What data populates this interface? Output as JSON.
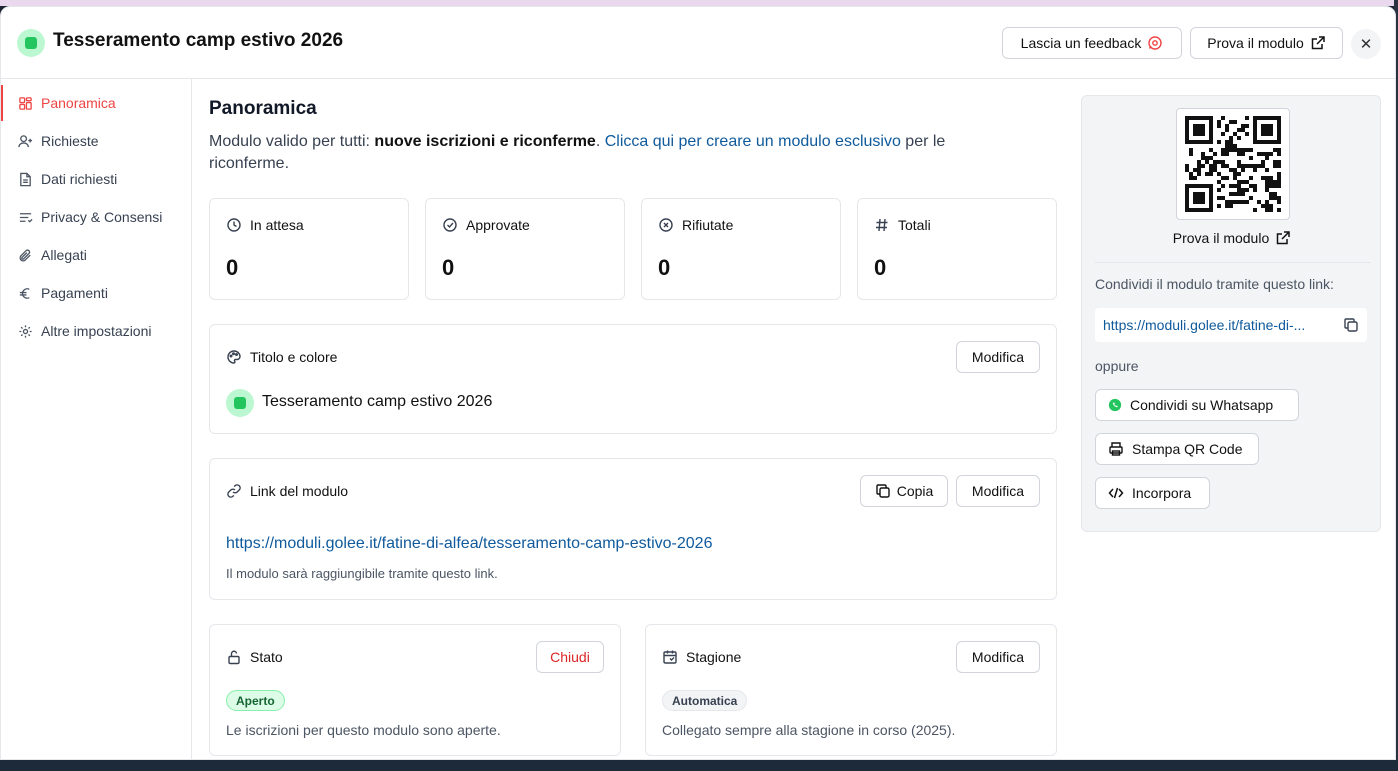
{
  "header": {
    "title": "Tesseramento camp estivo 2026",
    "feedback_label": "Lascia un feedback",
    "try_label": "Prova il modulo",
    "close_symbol": "✕",
    "accent_color": "#22c55e"
  },
  "sidebar": {
    "items": [
      {
        "label": "Panoramica",
        "icon": "grid-icon"
      },
      {
        "label": "Richieste",
        "icon": "user-plus-icon"
      },
      {
        "label": "Dati richiesti",
        "icon": "file-icon"
      },
      {
        "label": "Privacy & Consensi",
        "icon": "list-icon"
      },
      {
        "label": "Allegati",
        "icon": "paperclip-icon"
      },
      {
        "label": "Pagamenti",
        "icon": "euro-icon"
      },
      {
        "label": "Altre impostazioni",
        "icon": "gear-icon"
      }
    ],
    "active_color": "#ef4444"
  },
  "main": {
    "title": "Panoramica",
    "intro_prefix": "Modulo valido per tutti: ",
    "intro_bold": "nuove iscrizioni e riconferme",
    "intro_mid": ". ",
    "intro_link": "Clicca qui per creare un modulo esclusivo",
    "intro_suffix": " per le riconferme.",
    "stats": [
      {
        "label": "In attesa",
        "value": "0",
        "icon": "clock-icon"
      },
      {
        "label": "Approvate",
        "value": "0",
        "icon": "check-circle-icon"
      },
      {
        "label": "Rifiutate",
        "value": "0",
        "icon": "x-circle-icon"
      },
      {
        "label": "Totali",
        "value": "0",
        "icon": "hash-icon"
      }
    ],
    "title_card": {
      "heading": "Titolo e colore",
      "edit_label": "Modifica",
      "form_name": "Tesseramento camp estivo 2026"
    },
    "link_card": {
      "heading": "Link del modulo",
      "copy_label": "Copia",
      "edit_label": "Modifica",
      "url": "https://moduli.golee.it/fatine-di-alfea/tesseramento-camp-estivo-2026",
      "hint": "Il modulo sarà raggiungibile tramite questo link."
    },
    "status_card": {
      "heading": "Stato",
      "close_label": "Chiudi",
      "badge": "Aperto",
      "description": "Le iscrizioni per questo modulo sono aperte."
    },
    "season_card": {
      "heading": "Stagione",
      "edit_label": "Modifica",
      "badge": "Automatica",
      "description": "Collegato sempre alla stagione in corso (2025)."
    }
  },
  "right": {
    "try_label": "Prova il modulo",
    "share_text": "Condividi il modulo tramite questo link:",
    "short_url": "https://moduli.golee.it/fatine-di-...",
    "or_text": "oppure",
    "whatsapp_label": "Condividi su Whatsapp",
    "print_label": "Stampa QR Code",
    "embed_label": "Incorpora"
  }
}
